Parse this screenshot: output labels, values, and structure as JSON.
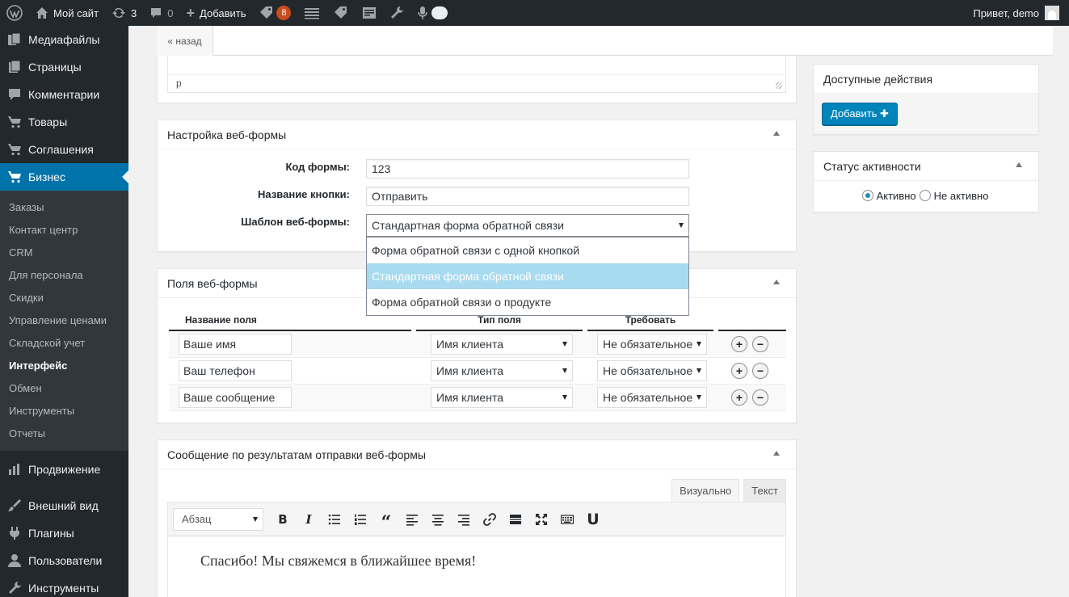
{
  "adminbar": {
    "site_name": "Мой сайт",
    "updates_count": "3",
    "comments_count": "0",
    "add_label": "Добавить",
    "notifications_count": "8",
    "greeting": "Привет, demo"
  },
  "sidebar": {
    "top_items": [
      {
        "label": "Медиафайлы",
        "icon": "media-icon"
      },
      {
        "label": "Страницы",
        "icon": "pages-icon"
      },
      {
        "label": "Комментарии",
        "icon": "comments-icon"
      },
      {
        "label": "Товары",
        "icon": "cart-icon"
      },
      {
        "label": "Соглашения",
        "icon": "cart-icon"
      },
      {
        "label": "Бизнес",
        "icon": "cart-icon"
      }
    ],
    "submenu": [
      "Заказы",
      "Контакт центр",
      "CRM",
      "Для персонала",
      "Скидки",
      "Управление ценами",
      "Складской учет",
      "Интерфейс",
      "Обмен",
      "Инструменты",
      "Отчеты"
    ],
    "bottom_items": [
      {
        "label": "Продвижение",
        "icon": "chart-icon"
      },
      {
        "label": "Внешний вид",
        "icon": "brush-icon"
      },
      {
        "label": "Плагины",
        "icon": "plugin-icon"
      },
      {
        "label": "Пользователи",
        "icon": "users-icon"
      },
      {
        "label": "Инструменты",
        "icon": "wrench-icon"
      }
    ]
  },
  "topbar": {
    "back_label": "« назад"
  },
  "editor_top": {
    "path": "p"
  },
  "settings": {
    "title": "Настройка веб-формы",
    "code_label": "Код формы:",
    "code_value": "123",
    "button_label": "Название кнопки:",
    "button_value": "Отправить",
    "template_label": "Шаблон веб-формы:",
    "template_value": "Стандартная форма обратной связи",
    "template_options": [
      "Форма обратной связи с одной кнопкой",
      "Стандартная форма обратной связи",
      "Форма обратной связи о продукте"
    ]
  },
  "fields": {
    "title": "Поля веб-формы",
    "columns": [
      "Название поля",
      "Тип поля",
      "Требовать"
    ],
    "rows": [
      {
        "name": "Ваше имя",
        "type": "Имя клиента",
        "required": "Не обязательное"
      },
      {
        "name": "Ваш телефон",
        "type": "Имя клиента",
        "required": "Не обязательное"
      },
      {
        "name": "Ваше сообщение",
        "type": "Имя клиента",
        "required": "Не обязательное"
      }
    ]
  },
  "message": {
    "title": "Сообщение по результатам отправки веб-формы",
    "tab_visual": "Визуально",
    "tab_text": "Текст",
    "format_value": "Абзац",
    "content": "Спасибо! Мы свяжемся в ближайшее время!"
  },
  "actions": {
    "title": "Доступные действия",
    "add_label": "Добавить ✚"
  },
  "status": {
    "title": "Статус активности",
    "active_label": "Активно",
    "inactive_label": "Не активно"
  },
  "colors": {
    "adminbar": "#23282d",
    "accent": "#0073aa",
    "button": "#0085ba",
    "badge": "#ca4a1f",
    "highlight": "#a8dbef"
  }
}
